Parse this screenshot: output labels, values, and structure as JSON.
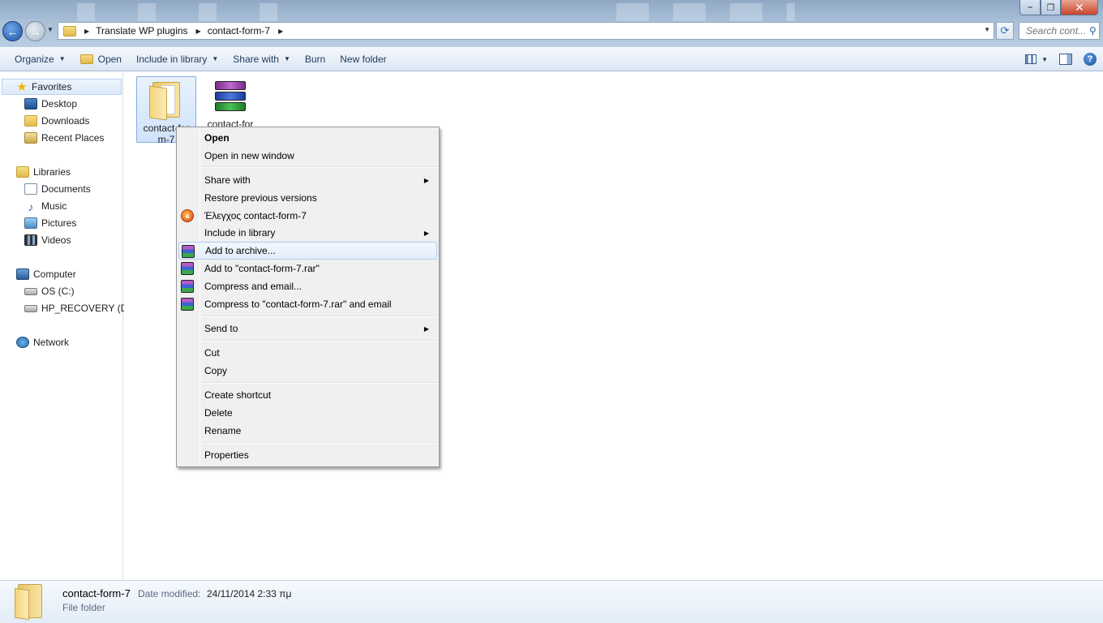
{
  "window": {
    "minimize_glyph": "–",
    "maximize_glyph": "❐",
    "close_glyph": "✕"
  },
  "nav": {
    "back_glyph": "←",
    "forward_glyph": "→",
    "breadcrumb": [
      "Translate WP plugins",
      "contact-form-7"
    ],
    "search_placeholder": "Search cont..."
  },
  "toolbar": {
    "organize": "Organize",
    "open": "Open",
    "include_in_library": "Include in library",
    "share_with": "Share with",
    "burn": "Burn",
    "new_folder": "New folder"
  },
  "sidebar": {
    "favorites": "Favorites",
    "desktop": "Desktop",
    "downloads": "Downloads",
    "recent_places": "Recent Places",
    "libraries": "Libraries",
    "documents": "Documents",
    "music": "Music",
    "pictures": "Pictures",
    "videos": "Videos",
    "computer": "Computer",
    "os_c": "OS (C:)",
    "hp_recovery": "HP_RECOVERY (D:)",
    "network": "Network"
  },
  "files": [
    {
      "name_line1": "contact-for",
      "name_line2": "m-7",
      "type": "folder"
    },
    {
      "name_line1": "contact-for",
      "type": "rar-archive"
    }
  ],
  "context_menu": {
    "open": "Open",
    "open_new_window": "Open in new window",
    "share_with": "Share with",
    "restore_previous": "Restore previous versions",
    "check_item": "Έλεγχος contact-form-7",
    "include_in_library": "Include in library",
    "add_to_archive": "Add to archive...",
    "add_to_rar": "Add to \"contact-form-7.rar\"",
    "compress_email": "Compress and email...",
    "compress_rar_email": "Compress to \"contact-form-7.rar\" and email",
    "send_to": "Send to",
    "cut": "Cut",
    "copy": "Copy",
    "create_shortcut": "Create shortcut",
    "delete": "Delete",
    "rename": "Rename",
    "properties": "Properties"
  },
  "details": {
    "name": "contact-form-7",
    "date_label": "Date modified:",
    "date_value": "24/11/2014 2:33 πμ",
    "type": "File folder"
  }
}
